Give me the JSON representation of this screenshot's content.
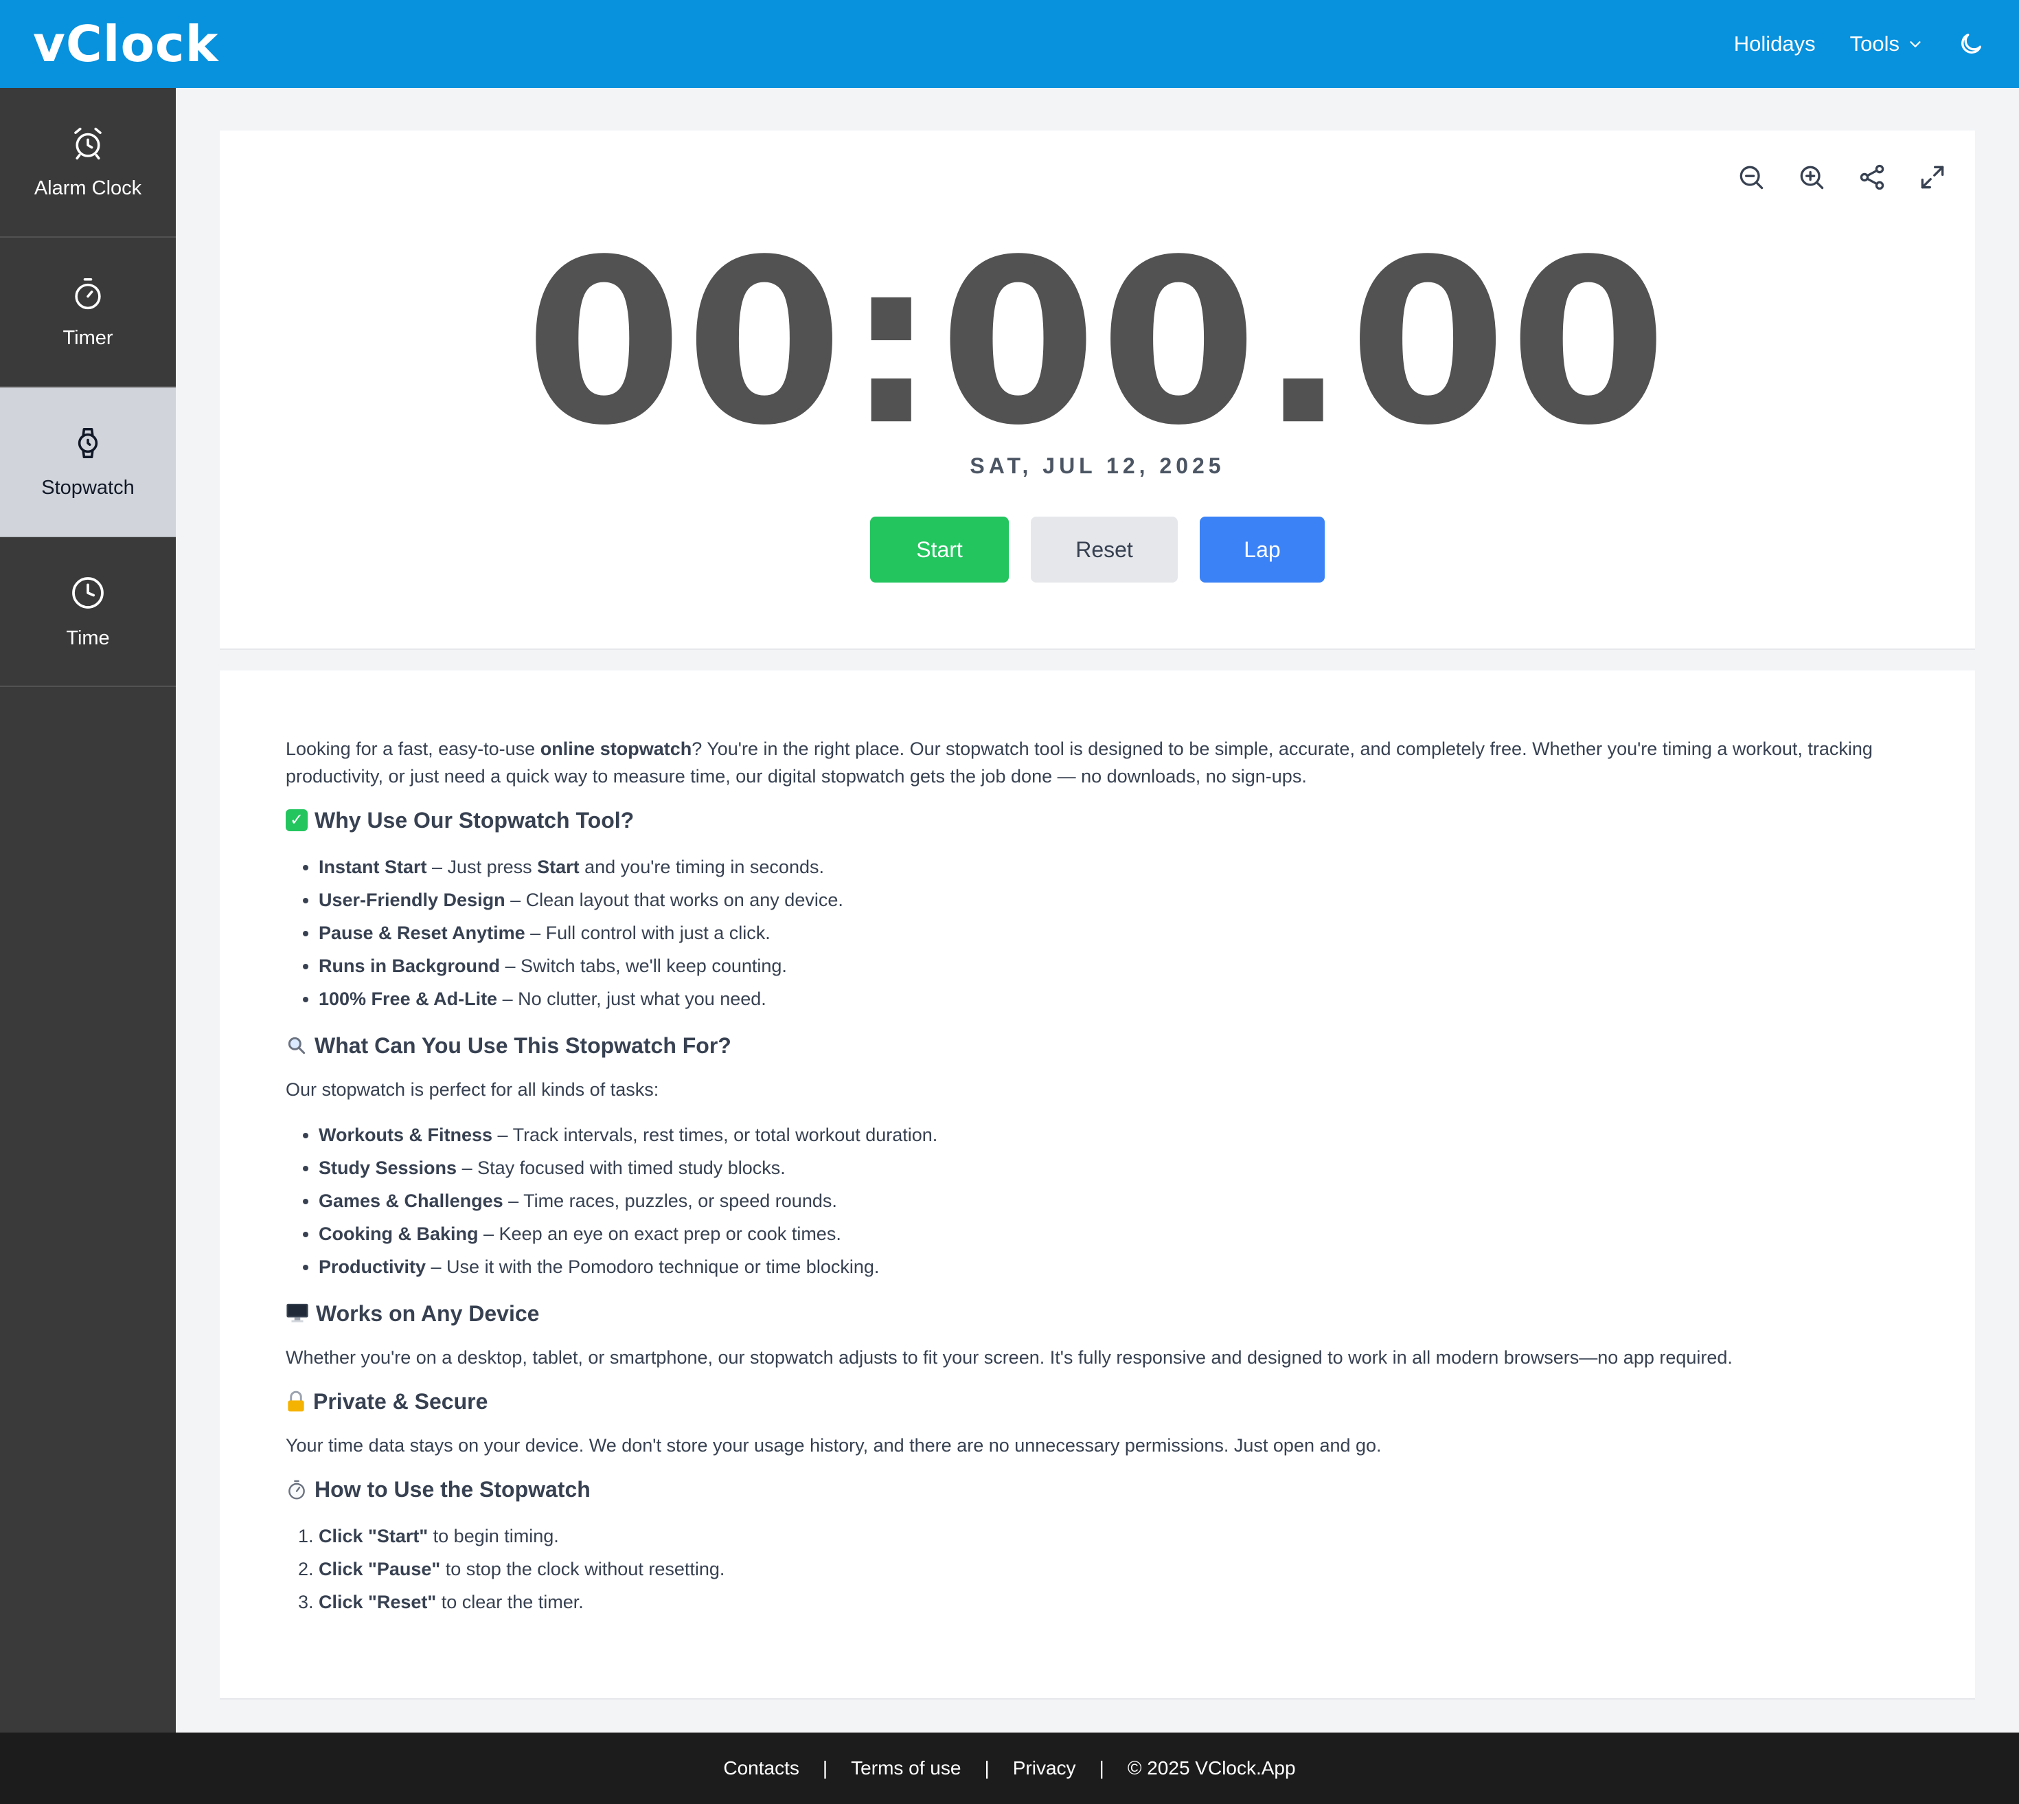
{
  "header": {
    "logo": "vClock",
    "nav_holidays": "Holidays",
    "nav_tools": "Tools",
    "theme_icon": "moon-icon"
  },
  "sidebar": {
    "items": [
      {
        "label": "Alarm Clock",
        "icon": "alarm-clock-icon"
      },
      {
        "label": "Timer",
        "icon": "timer-icon"
      },
      {
        "label": "Stopwatch",
        "icon": "watch-icon"
      },
      {
        "label": "Time",
        "icon": "clock-icon"
      }
    ],
    "active": "Stopwatch"
  },
  "stopwatch": {
    "display": "00:00.00",
    "date": "SAT, JUL 12, 2025",
    "start_label": "Start",
    "reset_label": "Reset",
    "lap_label": "Lap",
    "tool_icons": [
      "zoom-out-icon",
      "zoom-in-icon",
      "share-icon",
      "fullscreen-icon"
    ]
  },
  "content": {
    "intro_1": "Looking for a fast, easy-to-use ",
    "intro_bold": "online stopwatch",
    "intro_2": "? You're in the right place. Our stopwatch tool is designed to be simple, accurate, and completely free. Whether you're timing a workout, tracking productivity, or just need a quick way to measure time, our digital stopwatch gets the job done — no downloads, no sign-ups.",
    "why_heading": "Why Use Our Stopwatch Tool?",
    "why_items": [
      {
        "bold": "Instant Start",
        "text": " – Just press ",
        "bold2": "Start",
        "text2": " and you're timing in seconds."
      },
      {
        "bold": "User-Friendly Design",
        "text": " – Clean layout that works on any device."
      },
      {
        "bold": "Pause & Reset Anytime",
        "text": " – Full control with just a click."
      },
      {
        "bold": "Runs in Background",
        "text": " – Switch tabs, we'll keep counting."
      },
      {
        "bold": "100% Free & Ad-Lite",
        "text": " – No clutter, just what you need."
      }
    ],
    "use_heading": "What Can You Use This Stopwatch For?",
    "use_intro": "Our stopwatch is perfect for all kinds of tasks:",
    "use_items": [
      {
        "bold": "Workouts & Fitness",
        "text": " – Track intervals, rest times, or total workout duration."
      },
      {
        "bold": "Study Sessions",
        "text": " – Stay focused with timed study blocks."
      },
      {
        "bold": "Games & Challenges",
        "text": " – Time races, puzzles, or speed rounds."
      },
      {
        "bold": "Cooking & Baking",
        "text": " – Keep an eye on exact prep or cook times."
      },
      {
        "bold": "Productivity",
        "text": " – Use it with the Pomodoro technique or time blocking."
      }
    ],
    "device_heading": "Works on Any Device",
    "device_text": "Whether you're on a desktop, tablet, or smartphone, our stopwatch adjusts to fit your screen. It's fully responsive and designed to work in all modern browsers—no app required.",
    "private_heading": "Private & Secure",
    "private_text": "Your time data stays on your device. We don't store your usage history, and there are no unnecessary permissions. Just open and go.",
    "howto_heading": "How to Use the Stopwatch",
    "howto_items": [
      {
        "bold": "Click \"Start\"",
        "text": " to begin timing."
      },
      {
        "bold": "Click \"Pause\"",
        "text": " to stop the clock without resetting."
      },
      {
        "bold": "Click \"Reset\"",
        "text": " to clear the timer."
      }
    ]
  },
  "footer": {
    "contacts": "Contacts",
    "terms": "Terms of use",
    "privacy": "Privacy",
    "copyright": "© 2025 VClock.App",
    "separator": "|"
  },
  "colors": {
    "header_bg": "#0891dd",
    "sidebar_bg": "#3a3a3a",
    "active_bg": "#d1d5db",
    "start": "#22c55e",
    "reset": "#e5e7eb",
    "lap": "#3b82f6",
    "footer_bg": "#1c1c1c"
  }
}
